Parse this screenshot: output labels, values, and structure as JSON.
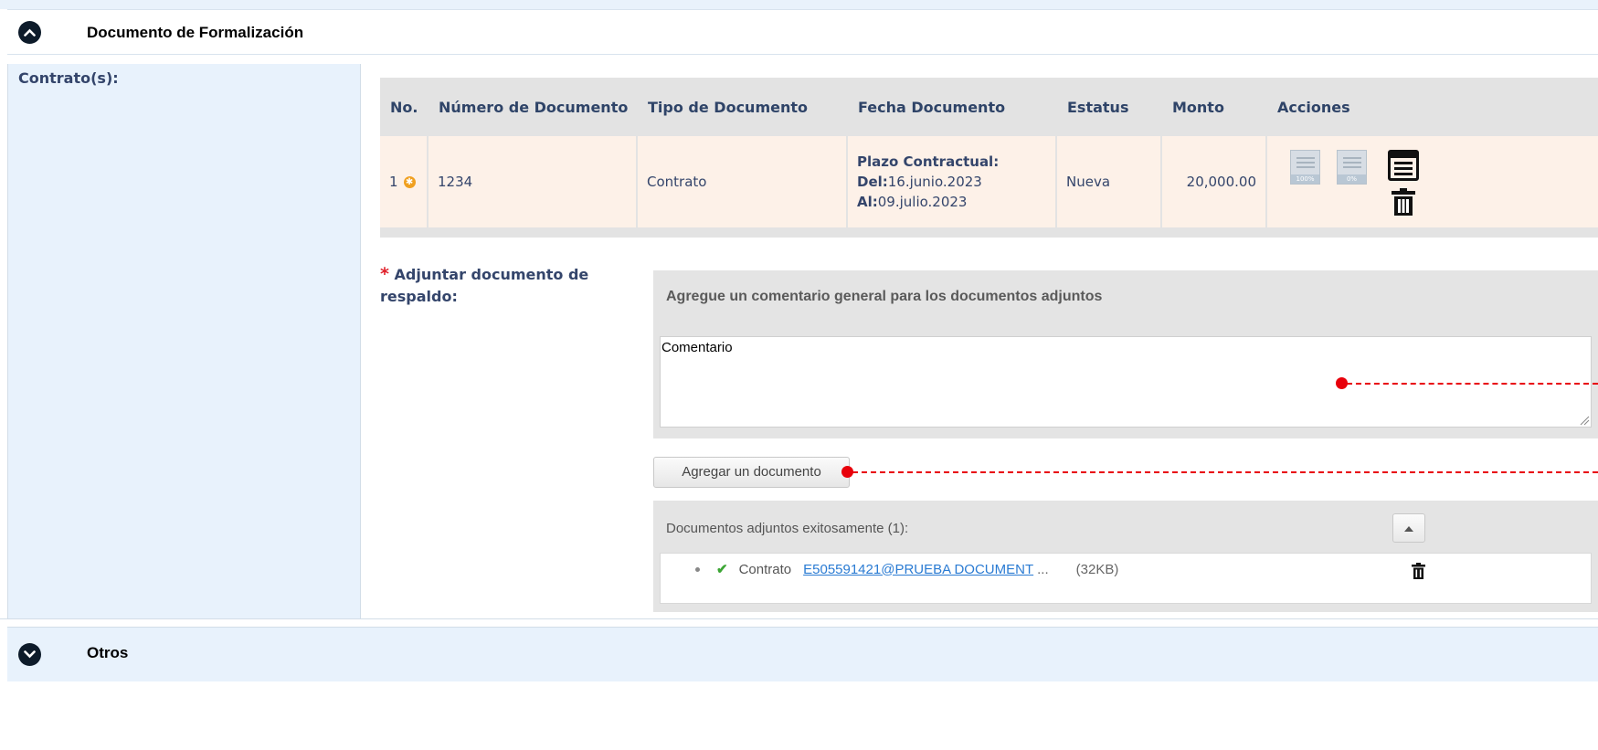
{
  "section_formalizacion": {
    "title": "Documento de Formalización",
    "toggle_icon": "chevron-up-icon"
  },
  "contratos": {
    "label": "Contrato(s):",
    "table": {
      "headers": {
        "no": "No.",
        "numero": "Número de Documento",
        "tipo": "Tipo de Documento",
        "fecha": "Fecha Documento",
        "estatus": "Estatus",
        "monto": "Monto",
        "acciones": "Acciones"
      },
      "rows": [
        {
          "no": "1",
          "status_icon": "new-badge-icon",
          "numero": "1234",
          "tipo": "Contrato",
          "plazo_label": "Plazo Contractual:",
          "del_label": "Del:",
          "del_value": "16.junio.2023",
          "al_label": "Al:",
          "al_value": "09.julio.2023",
          "estatus": "Nueva",
          "monto": "20,000.00",
          "action_badge_full": "100%",
          "action_badge_zero": "0%"
        }
      ]
    }
  },
  "adjuntar": {
    "required_mark": "*",
    "label": "Adjuntar documento de respaldo:",
    "comment_header": "Agregue un comentario general para los documentos adjuntos",
    "comment_value": "Comentario",
    "add_button": "Agregar un documento",
    "attached_header": "Documentos adjuntos exitosamente (1):",
    "files": [
      {
        "type": "Contrato",
        "name": "E505591421@PRUEBA DOCUMENT",
        "ellipsis": "...",
        "size": "(32KB)"
      }
    ]
  },
  "section_otros": {
    "title": "Otros",
    "toggle_icon": "chevron-down-icon"
  },
  "colors": {
    "annotation_marker": "#e8000b",
    "row_background": "#fdf1e8",
    "label_background": "#e8f2fc",
    "header_text": "#2f4468"
  }
}
